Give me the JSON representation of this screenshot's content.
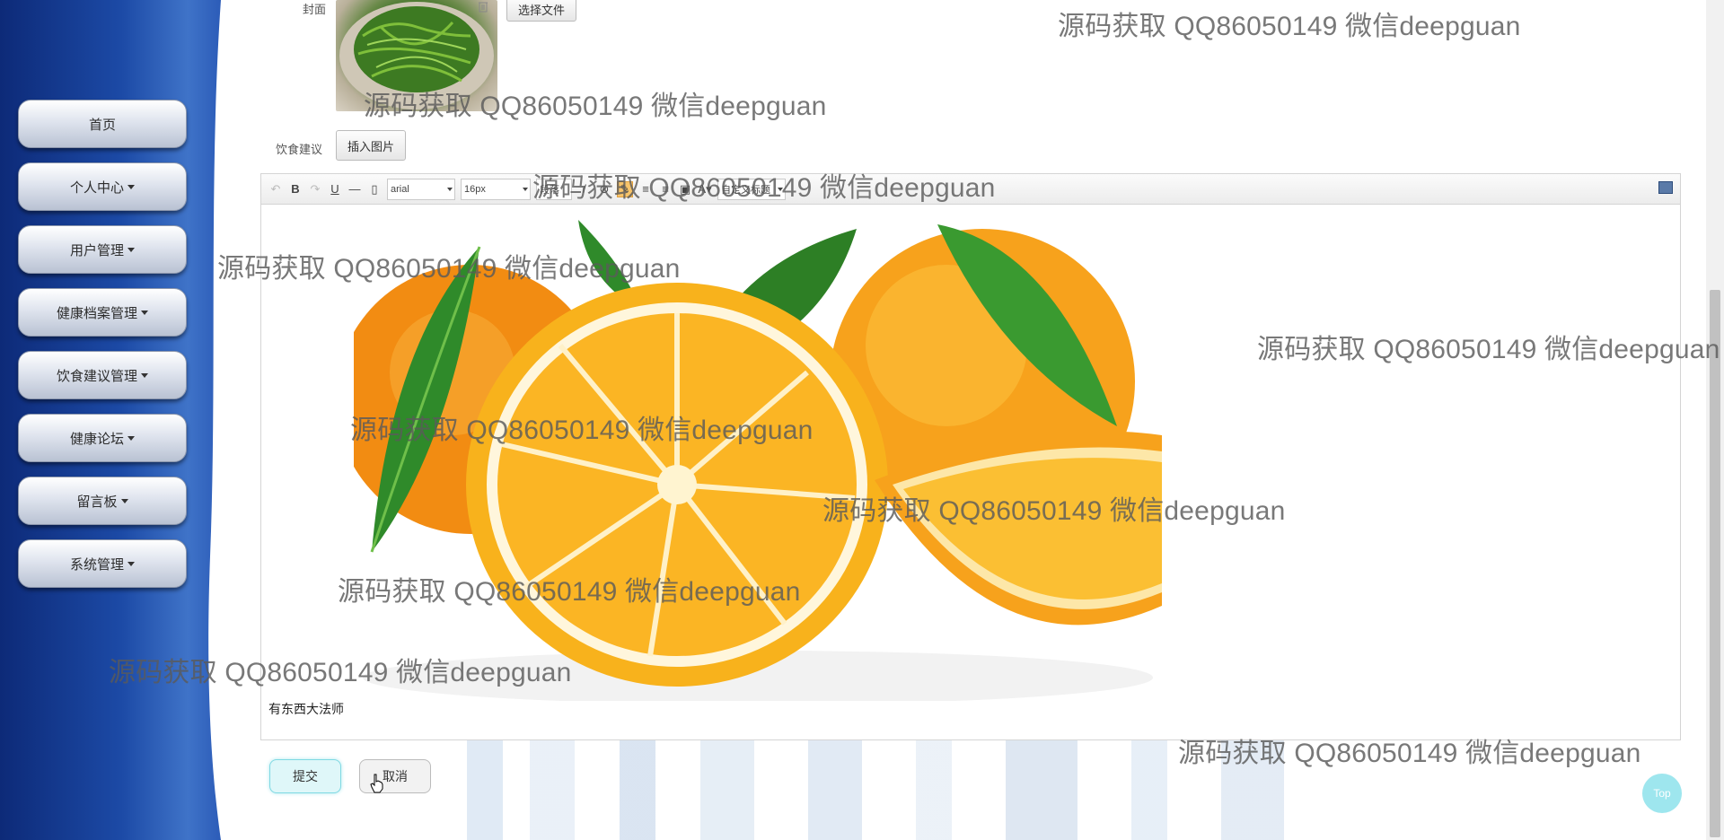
{
  "sidebar": {
    "items": [
      {
        "label": "首页",
        "has_caret": false
      },
      {
        "label": "个人中心",
        "has_caret": true
      },
      {
        "label": "用户管理",
        "has_caret": true
      },
      {
        "label": "健康档案管理",
        "has_caret": true
      },
      {
        "label": "饮食建议管理",
        "has_caret": true
      },
      {
        "label": "健康论坛",
        "has_caret": true
      },
      {
        "label": "留言板",
        "has_caret": true
      },
      {
        "label": "系统管理",
        "has_caret": true
      }
    ]
  },
  "form": {
    "cover_label": "封面",
    "choose_file_label": "选择文件",
    "diet_label": "饮食建议",
    "insert_image_label": "插入图片"
  },
  "editor": {
    "toolbar": {
      "bold": "B",
      "underline": "U",
      "font_family": "arial",
      "font_size": "16px",
      "paragraph": "段落",
      "custom_title": "自定义标题",
      "font_color": "A"
    },
    "content_text": "有东西大法师"
  },
  "actions": {
    "submit_label": "提交",
    "cancel_label": "取消",
    "top_label": "Top"
  },
  "watermark": {
    "text": "源码获取 QQ86050149 微信deepguan"
  },
  "colors": {
    "sidebar_dark": "#0d2a78",
    "sidebar_light": "#3f73c8",
    "submit_border": "#7fd9e3",
    "top_button": "#9ee6ee"
  }
}
